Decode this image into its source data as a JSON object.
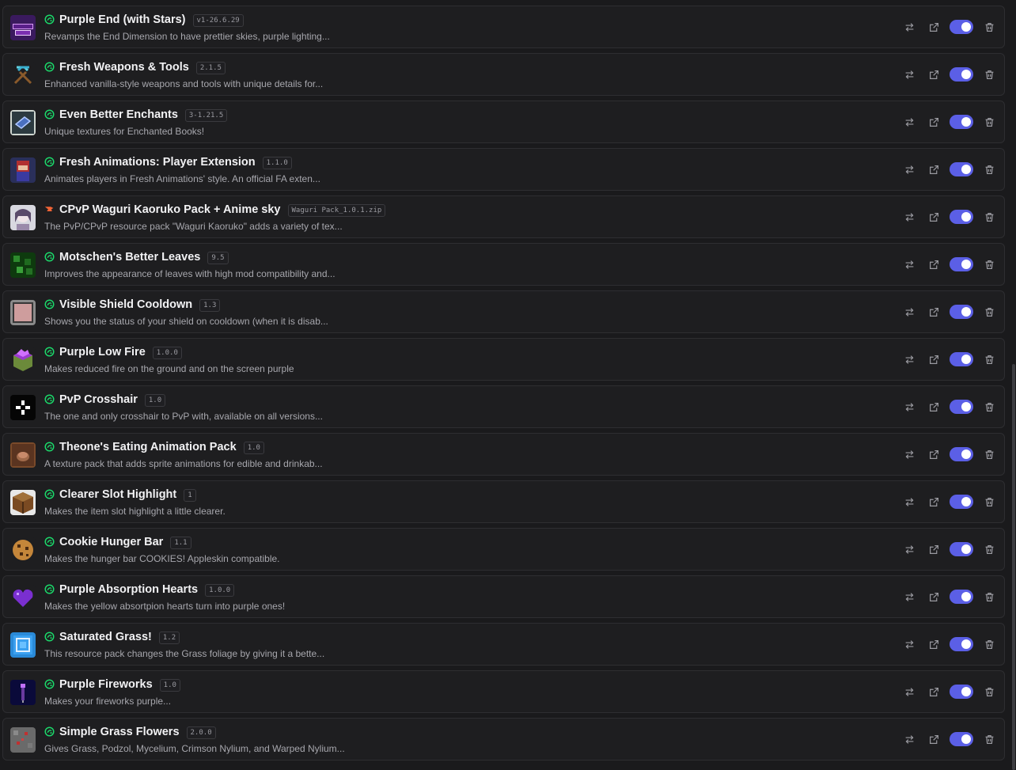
{
  "colors": {
    "accent": "#5b5fe6",
    "modrinth_green": "#1bd96a",
    "curseforge_orange": "#f16436"
  },
  "packs": [
    {
      "title": "Purple End (with Stars)",
      "version": "v1-26.6.29",
      "description": "Revamps the End Dimension to have prettier skies, purple lighting...",
      "source": "modrinth-icon",
      "icon": "purple-end-logo",
      "enabled": true
    },
    {
      "title": "Fresh Weapons & Tools",
      "version": "2.1.5",
      "description": "Enhanced vanilla-style weapons and tools with unique details for...",
      "source": "modrinth-icon",
      "icon": "crossed-pickaxes-icon",
      "enabled": true
    },
    {
      "title": "Even Better Enchants",
      "version": "3-1.21.5",
      "description": "Unique textures for Enchanted Books!",
      "source": "modrinth-icon",
      "icon": "enchanted-book-icon",
      "enabled": true
    },
    {
      "title": "Fresh Animations: Player Extension",
      "version": "1.1.0",
      "description": "Animates players in Fresh Animations' style. An official FA exten...",
      "source": "modrinth-icon",
      "icon": "player-head-icon",
      "enabled": true
    },
    {
      "title": "CPvP Waguri Kaoruko Pack + Anime sky",
      "version": "Waguri Pack_1.0.1.zip",
      "description": "The PvP/CPvP resource pack \"Waguri Kaoruko\" adds a variety of tex...",
      "source": "curseforge-icon",
      "icon": "anime-portrait-icon",
      "enabled": true
    },
    {
      "title": "Motschen's Better Leaves",
      "version": "9.5",
      "description": "Improves the appearance of leaves with high mod compatibility and...",
      "source": "modrinth-icon",
      "icon": "leaves-block-icon",
      "enabled": true
    },
    {
      "title": "Visible Shield Cooldown",
      "version": "1.3",
      "description": "Shows you the status of your shield on cooldown (when it is disab...",
      "source": "modrinth-icon",
      "icon": "shield-slot-icon",
      "enabled": true
    },
    {
      "title": "Purple Low Fire",
      "version": "1.0.0",
      "description": "Makes reduced fire on the ground and on the screen purple",
      "source": "modrinth-icon",
      "icon": "purple-fire-block-icon",
      "enabled": true
    },
    {
      "title": "PvP Crosshair",
      "version": "1.0",
      "description": "The one and only crosshair to PvP with, available on all versions...",
      "source": "modrinth-icon",
      "icon": "crosshair-icon",
      "enabled": true
    },
    {
      "title": "Theone's Eating Animation Pack",
      "version": "1.0",
      "description": "A texture pack that adds sprite animations for edible and drinkab...",
      "source": "modrinth-icon",
      "icon": "food-item-icon",
      "enabled": true
    },
    {
      "title": "Clearer Slot Highlight",
      "version": "1",
      "description": "Makes the item slot highlight a little clearer.",
      "source": "modrinth-icon",
      "icon": "crafting-table-icon",
      "enabled": true
    },
    {
      "title": "Cookie Hunger Bar",
      "version": "1.1",
      "description": "Makes the hunger bar COOKIES! Appleskin compatible.",
      "source": "modrinth-icon",
      "icon": "cookie-icon",
      "enabled": true
    },
    {
      "title": "Purple Absorption Hearts",
      "version": "1.0.0",
      "description": "Makes the yellow absortpion hearts turn into purple ones!",
      "source": "modrinth-icon",
      "icon": "purple-heart-icon",
      "enabled": true
    },
    {
      "title": "Saturated Grass!",
      "version": "1.2",
      "description": "This resource pack changes the Grass foliage by giving it a bette...",
      "source": "modrinth-icon",
      "icon": "grass-pack-icon",
      "enabled": true
    },
    {
      "title": "Purple Fireworks",
      "version": "1.0",
      "description": "Makes your fireworks purple...",
      "source": "modrinth-icon",
      "icon": "firework-rocket-icon",
      "enabled": true
    },
    {
      "title": "Simple Grass Flowers",
      "version": "2.0.0",
      "description": "Gives Grass, Podzol, Mycelium, Crimson Nylium, and Warped Nylium...",
      "source": "modrinth-icon",
      "icon": "flowered-grass-icon",
      "enabled": true
    }
  ]
}
